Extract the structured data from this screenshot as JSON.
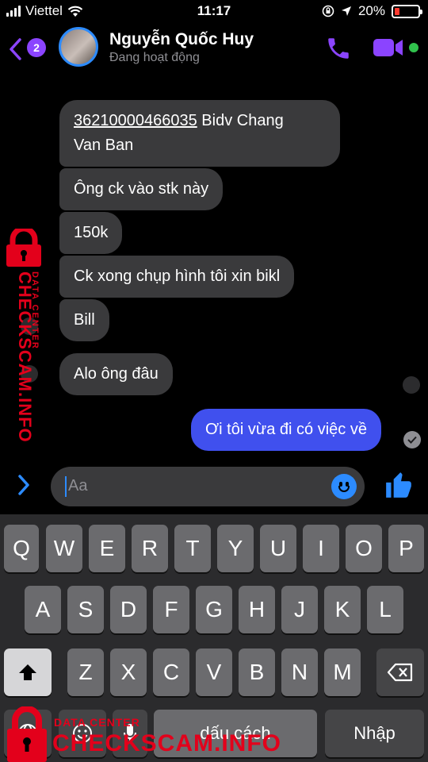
{
  "status_bar": {
    "carrier": "Viettel",
    "time": "11:17",
    "battery_percent": "20%",
    "battery_level": 0.2,
    "battery_color": "#ff3b30",
    "icons": [
      "signal-icon",
      "wifi-icon",
      "orientation-lock-icon",
      "location-icon",
      "battery-icon"
    ]
  },
  "header": {
    "unread_count": "2",
    "contact_name": "Nguyễn Quốc Huy",
    "contact_status": "Đang hoạt động",
    "accent_color": "#8b44ff",
    "online_color": "#31c24d"
  },
  "messages": {
    "incoming": [
      {
        "account_number": "36210000466035",
        "rest_line1": " Bidv Chang",
        "line2": "Van Ban"
      },
      {
        "text": "Ông ck vào stk này"
      },
      {
        "text": "150k"
      },
      {
        "text": "Ck xong chụp hình tôi xin bikl"
      },
      {
        "text": "Bill"
      },
      {
        "text": "Alo ông đâu"
      }
    ],
    "outgoing": [
      {
        "text": "Ơi tôi vừa đi có việc về"
      }
    ],
    "outgoing_color": "#4050ee"
  },
  "composer": {
    "placeholder": "Aa"
  },
  "keyboard": {
    "row1": [
      "Q",
      "W",
      "E",
      "R",
      "T",
      "Y",
      "U",
      "I",
      "O",
      "P"
    ],
    "row2": [
      "A",
      "S",
      "D",
      "F",
      "G",
      "H",
      "J",
      "K",
      "L"
    ],
    "row3": [
      "Z",
      "X",
      "C",
      "V",
      "B",
      "N",
      "M"
    ],
    "space_label": "dấu cách",
    "return_label": "Nhập"
  },
  "watermark": {
    "brand": "CHECKSCAM.INFO",
    "subtitle": "DATA CENTER",
    "color": "#e3001b"
  }
}
